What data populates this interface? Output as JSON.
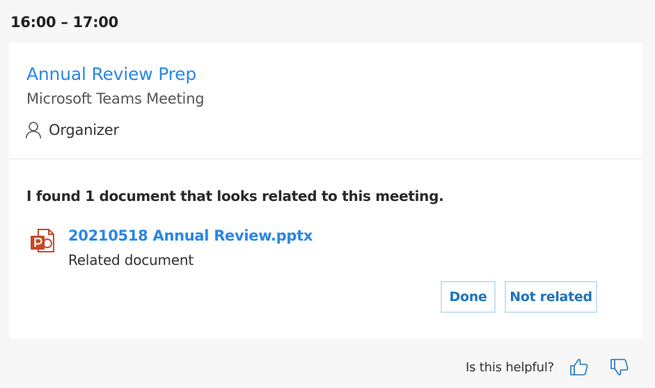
{
  "time_range": "16:00 – 17:00",
  "meeting": {
    "title": "Annual Review Prep",
    "subtitle": "Microsoft Teams Meeting",
    "organizer_label": "Organizer"
  },
  "suggestion": {
    "message": "I found 1 document that looks related to this meeting.",
    "document": {
      "name": "20210518 Annual Review.pptx",
      "caption": "Related document",
      "icon": "powerpoint-file-icon"
    },
    "buttons": {
      "done_label": "Done",
      "not_related_label": "Not related"
    }
  },
  "feedback": {
    "prompt": "Is this helpful?",
    "thumbs_up_icon": "thumbs-up-icon",
    "thumbs_down_icon": "thumbs-down-icon"
  },
  "colors": {
    "link": "#2b87e3",
    "button_border": "#c6e2f2",
    "powerpoint": "#c8472b",
    "background": "#f7f7f7"
  }
}
